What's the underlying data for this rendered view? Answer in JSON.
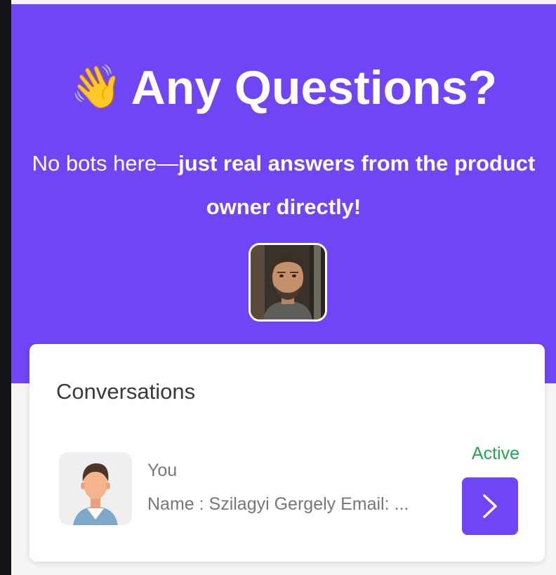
{
  "hero": {
    "wave_emoji": "👋",
    "title": "Any Questions?",
    "subtitle_plain": "No bots here—",
    "subtitle_bold": "just real answers from the product owner directly!"
  },
  "conversations": {
    "heading": "Conversations",
    "items": [
      {
        "sender": "You",
        "preview": "Name : Szilagyi Gergely Email: ...",
        "status": "Active"
      }
    ]
  },
  "colors": {
    "brand": "#7045f5",
    "active_status": "#22a64e",
    "page_bg": "#121418"
  },
  "icons": {
    "owner_avatar": "owner-photo",
    "user_avatar": "default-user-avatar-icon",
    "open_button": "chevron-right-icon"
  }
}
